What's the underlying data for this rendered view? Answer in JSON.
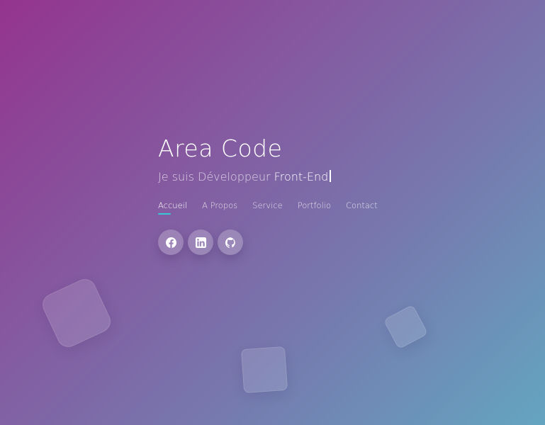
{
  "hero": {
    "title": "Area Code",
    "subtitle_prefix": "Je suis Développeur ",
    "subtitle_typed": "Front-End"
  },
  "nav": {
    "items": [
      {
        "label": "Accueil",
        "active": true
      },
      {
        "label": "A Propos",
        "active": false
      },
      {
        "label": "Service",
        "active": false
      },
      {
        "label": "Portfolio",
        "active": false
      },
      {
        "label": "Contact",
        "active": false
      }
    ]
  },
  "socials": [
    {
      "icon": "facebook-icon"
    },
    {
      "icon": "linkedin-icon"
    },
    {
      "icon": "github-icon"
    }
  ],
  "colors": {
    "gradient_start": "#94348f",
    "gradient_end": "#64a5c1",
    "nav_underline": "#37c7d9",
    "text": "#ffffff"
  }
}
